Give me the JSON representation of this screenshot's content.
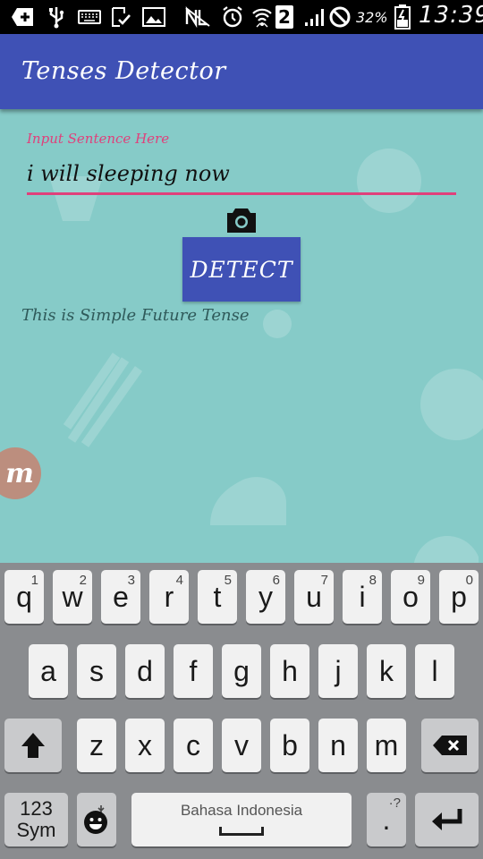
{
  "status_bar": {
    "sim_label": "2",
    "battery_percent": "32%",
    "time": "13:39",
    "icons": [
      "add-box-icon",
      "usb-icon",
      "keyboard-icon",
      "download-done-icon",
      "image-icon",
      "nfc-off-icon",
      "alarm-icon",
      "wifi-icon",
      "sim-icon",
      "signal-icon",
      "no-entry-icon",
      "battery-icon"
    ]
  },
  "app_bar": {
    "title": "Tenses Detector",
    "color": "#3F51B5"
  },
  "form": {
    "input_label": "Input Sentence Here",
    "input_value": "i will sleeping now",
    "accent_color": "#E0407B",
    "camera_icon": "camera-icon",
    "detect_label": "DETECT"
  },
  "result": {
    "text": "This is Simple Future Tense"
  },
  "floating_badge": {
    "label": "m"
  },
  "keyboard": {
    "row1": [
      {
        "main": "q",
        "hint": "1"
      },
      {
        "main": "w",
        "hint": "2"
      },
      {
        "main": "e",
        "hint": "3"
      },
      {
        "main": "r",
        "hint": "4"
      },
      {
        "main": "t",
        "hint": "5"
      },
      {
        "main": "y",
        "hint": "6"
      },
      {
        "main": "u",
        "hint": "7"
      },
      {
        "main": "i",
        "hint": "8"
      },
      {
        "main": "o",
        "hint": "9"
      },
      {
        "main": "p",
        "hint": "0"
      }
    ],
    "row2": [
      "a",
      "s",
      "d",
      "f",
      "g",
      "h",
      "j",
      "k",
      "l"
    ],
    "row3": [
      "z",
      "x",
      "c",
      "v",
      "b",
      "n",
      "m"
    ],
    "sym_line1": "123",
    "sym_line2": "Sym",
    "space_label": "Bahasa Indonesia",
    "period_main": ".",
    "period_hint": "·?",
    "shift_icon": "shift-icon",
    "backspace_icon": "backspace-icon",
    "emoji_icon": "emoji-icon",
    "enter_icon": "enter-icon"
  }
}
